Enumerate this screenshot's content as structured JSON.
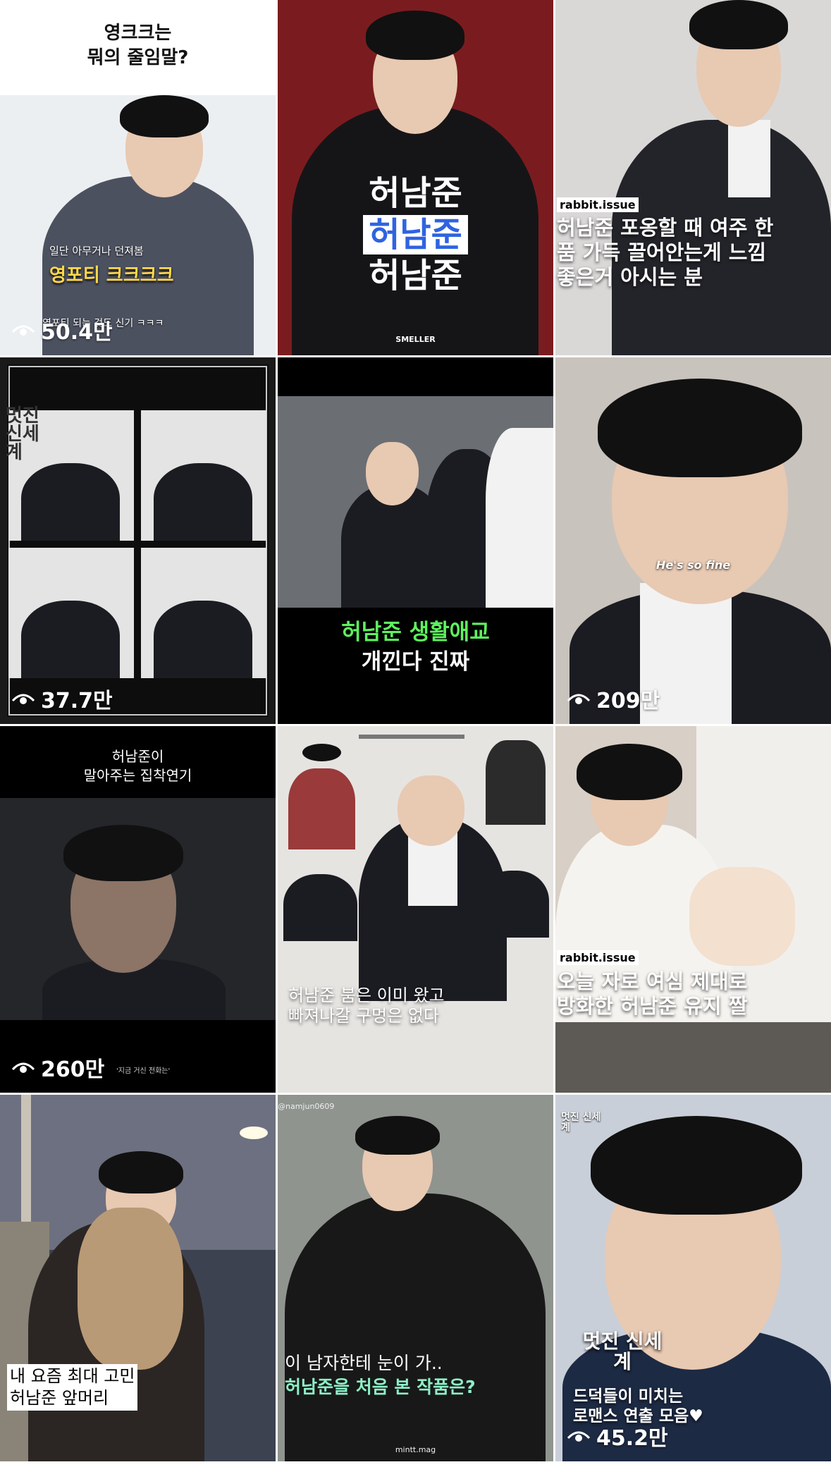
{
  "tiles": {
    "t1": {
      "title_line1": "영크크는",
      "title_line2": "뭐의 줄임말?",
      "sub": "일단 아무거나 던져봄",
      "highlight": "영포티 크크크크",
      "bottom": "영포티 되는 것도 신기 ㅋㅋㅋ",
      "views": "50.4만"
    },
    "t2": {
      "line1": "허남준",
      "line2": "허남준",
      "line3": "허남준",
      "brand": "SMELLER"
    },
    "t3": {
      "tag": "rabbit.issue",
      "caption": "허남준 포옹할 때 여주 한 품 가득 끌어안는게 느낌 좋은거 아시는 분"
    },
    "t4": {
      "logo": "멋진 신세계",
      "views": "37.7만"
    },
    "t5": {
      "line1": "허남준 생활애교",
      "line2": "개낀다 진짜"
    },
    "t6": {
      "overlay": "He's so fine",
      "views": "209만"
    },
    "t7": {
      "line1": "허남준이",
      "line2": "말아주는 집착연기",
      "sub": "'지금 거신 전화는'",
      "views": "260만"
    },
    "t8": {
      "line1": "허남준 붐은 이미 왔고",
      "line2": "빠져나갈 구멍은 없다"
    },
    "t9": {
      "tag": "rabbit.issue",
      "line1": "오늘 자로 여심 제대로",
      "line2": "방화한 허남준 유지 짤"
    },
    "t10": {
      "line1": "내 요즘 최대 고민",
      "line2": "허남준 앞머리"
    },
    "t11": {
      "handle": "@namjun0609",
      "line1": "이 남자한테 눈이 가..",
      "line2": "허남준을 처음 본 작품은?",
      "brand": "mintt.mag"
    },
    "t12": {
      "logo_top": "멋진 신세계",
      "logo_mid": "멋진 신세계",
      "line1": "드덕들이 미치는",
      "line2": "로맨스 연출 모음♥",
      "views": "45.2만"
    }
  },
  "colors": {
    "green": "#5ef25e",
    "mint": "#8ef0c8",
    "blue": "#2f63e0",
    "yellow": "#ffd84a"
  }
}
